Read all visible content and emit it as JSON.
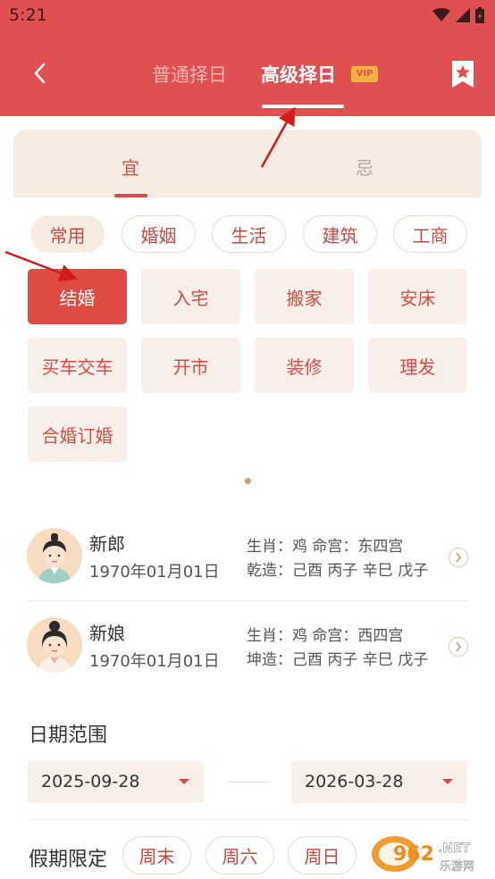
{
  "status_bar": {
    "time": "5:21"
  },
  "header": {
    "tab_normal": "普通择日",
    "tab_advanced": "高级择日",
    "vip_badge": "VIP"
  },
  "yi_ji_tabs": {
    "yi": "宜",
    "ji": "忌",
    "selected": "宜"
  },
  "categories": [
    {
      "label": "常用",
      "selected": true
    },
    {
      "label": "婚姻",
      "selected": false
    },
    {
      "label": "生活",
      "selected": false
    },
    {
      "label": "建筑",
      "selected": false
    },
    {
      "label": "工商",
      "selected": false
    }
  ],
  "events": [
    {
      "label": "结婚",
      "selected": true
    },
    {
      "label": "入宅",
      "selected": false
    },
    {
      "label": "搬家",
      "selected": false
    },
    {
      "label": "安床",
      "selected": false
    },
    {
      "label": "买车交车",
      "selected": false
    },
    {
      "label": "开市",
      "selected": false
    },
    {
      "label": "装修",
      "selected": false
    },
    {
      "label": "理发",
      "selected": false
    },
    {
      "label": "合婚订婚",
      "selected": false
    }
  ],
  "groom": {
    "role": "新郎",
    "birth": "1970年01月01日",
    "zodiac_line": "生肖：鸡 命宫：东四宫",
    "bazi_line": "乾造：己酉 丙子 辛巳 戊子"
  },
  "bride": {
    "role": "新娘",
    "birth": "1970年01月01日",
    "zodiac_line": "生肖：鸡 命宫：西四宫",
    "bazi_line": "坤造：己酉 丙子 辛巳 戊子"
  },
  "date_range": {
    "title": "日期范围",
    "start": "2025-09-28",
    "end": "2026-03-28"
  },
  "holiday": {
    "title": "假期限定",
    "options": [
      "周末",
      "周六",
      "周日"
    ]
  },
  "watermark": {
    "main": "962",
    "suffix": ".NET",
    "sub": "乐游网"
  },
  "colors": {
    "header_red": "#e05050",
    "accent_red": "#d94b44",
    "beige": "#f6ece2",
    "vip_gold": "#f4b03c"
  }
}
